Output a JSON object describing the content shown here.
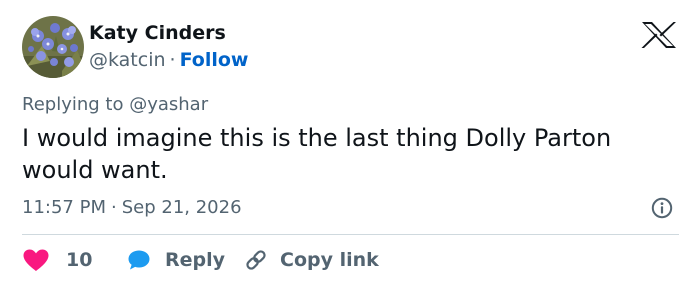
{
  "author": {
    "name": "Katy Cinders",
    "handle": "@katcin",
    "separator": "·",
    "follow_label": "Follow"
  },
  "reply_context": "Replying to @yashar",
  "tweet": {
    "text": "I would imagine this is the last thing Dolly Parton would want."
  },
  "timestamp": {
    "time": "11:57 PM",
    "separator": "·",
    "date": "Sep 21, 2026"
  },
  "actions": {
    "like_count": "10",
    "reply_label": "Reply",
    "copy_link_label": "Copy link"
  },
  "icons": {
    "logo": "x-logo-icon",
    "info": "info-icon",
    "like": "heart-icon",
    "reply": "speech-bubble-icon",
    "copy_link": "link-icon"
  },
  "colors": {
    "text": "#0f1419",
    "secondary_text": "#536471",
    "follow": "#0063c9",
    "like": "#f91880",
    "reply": "#1d9bf0",
    "divider": "#cfd9de"
  }
}
